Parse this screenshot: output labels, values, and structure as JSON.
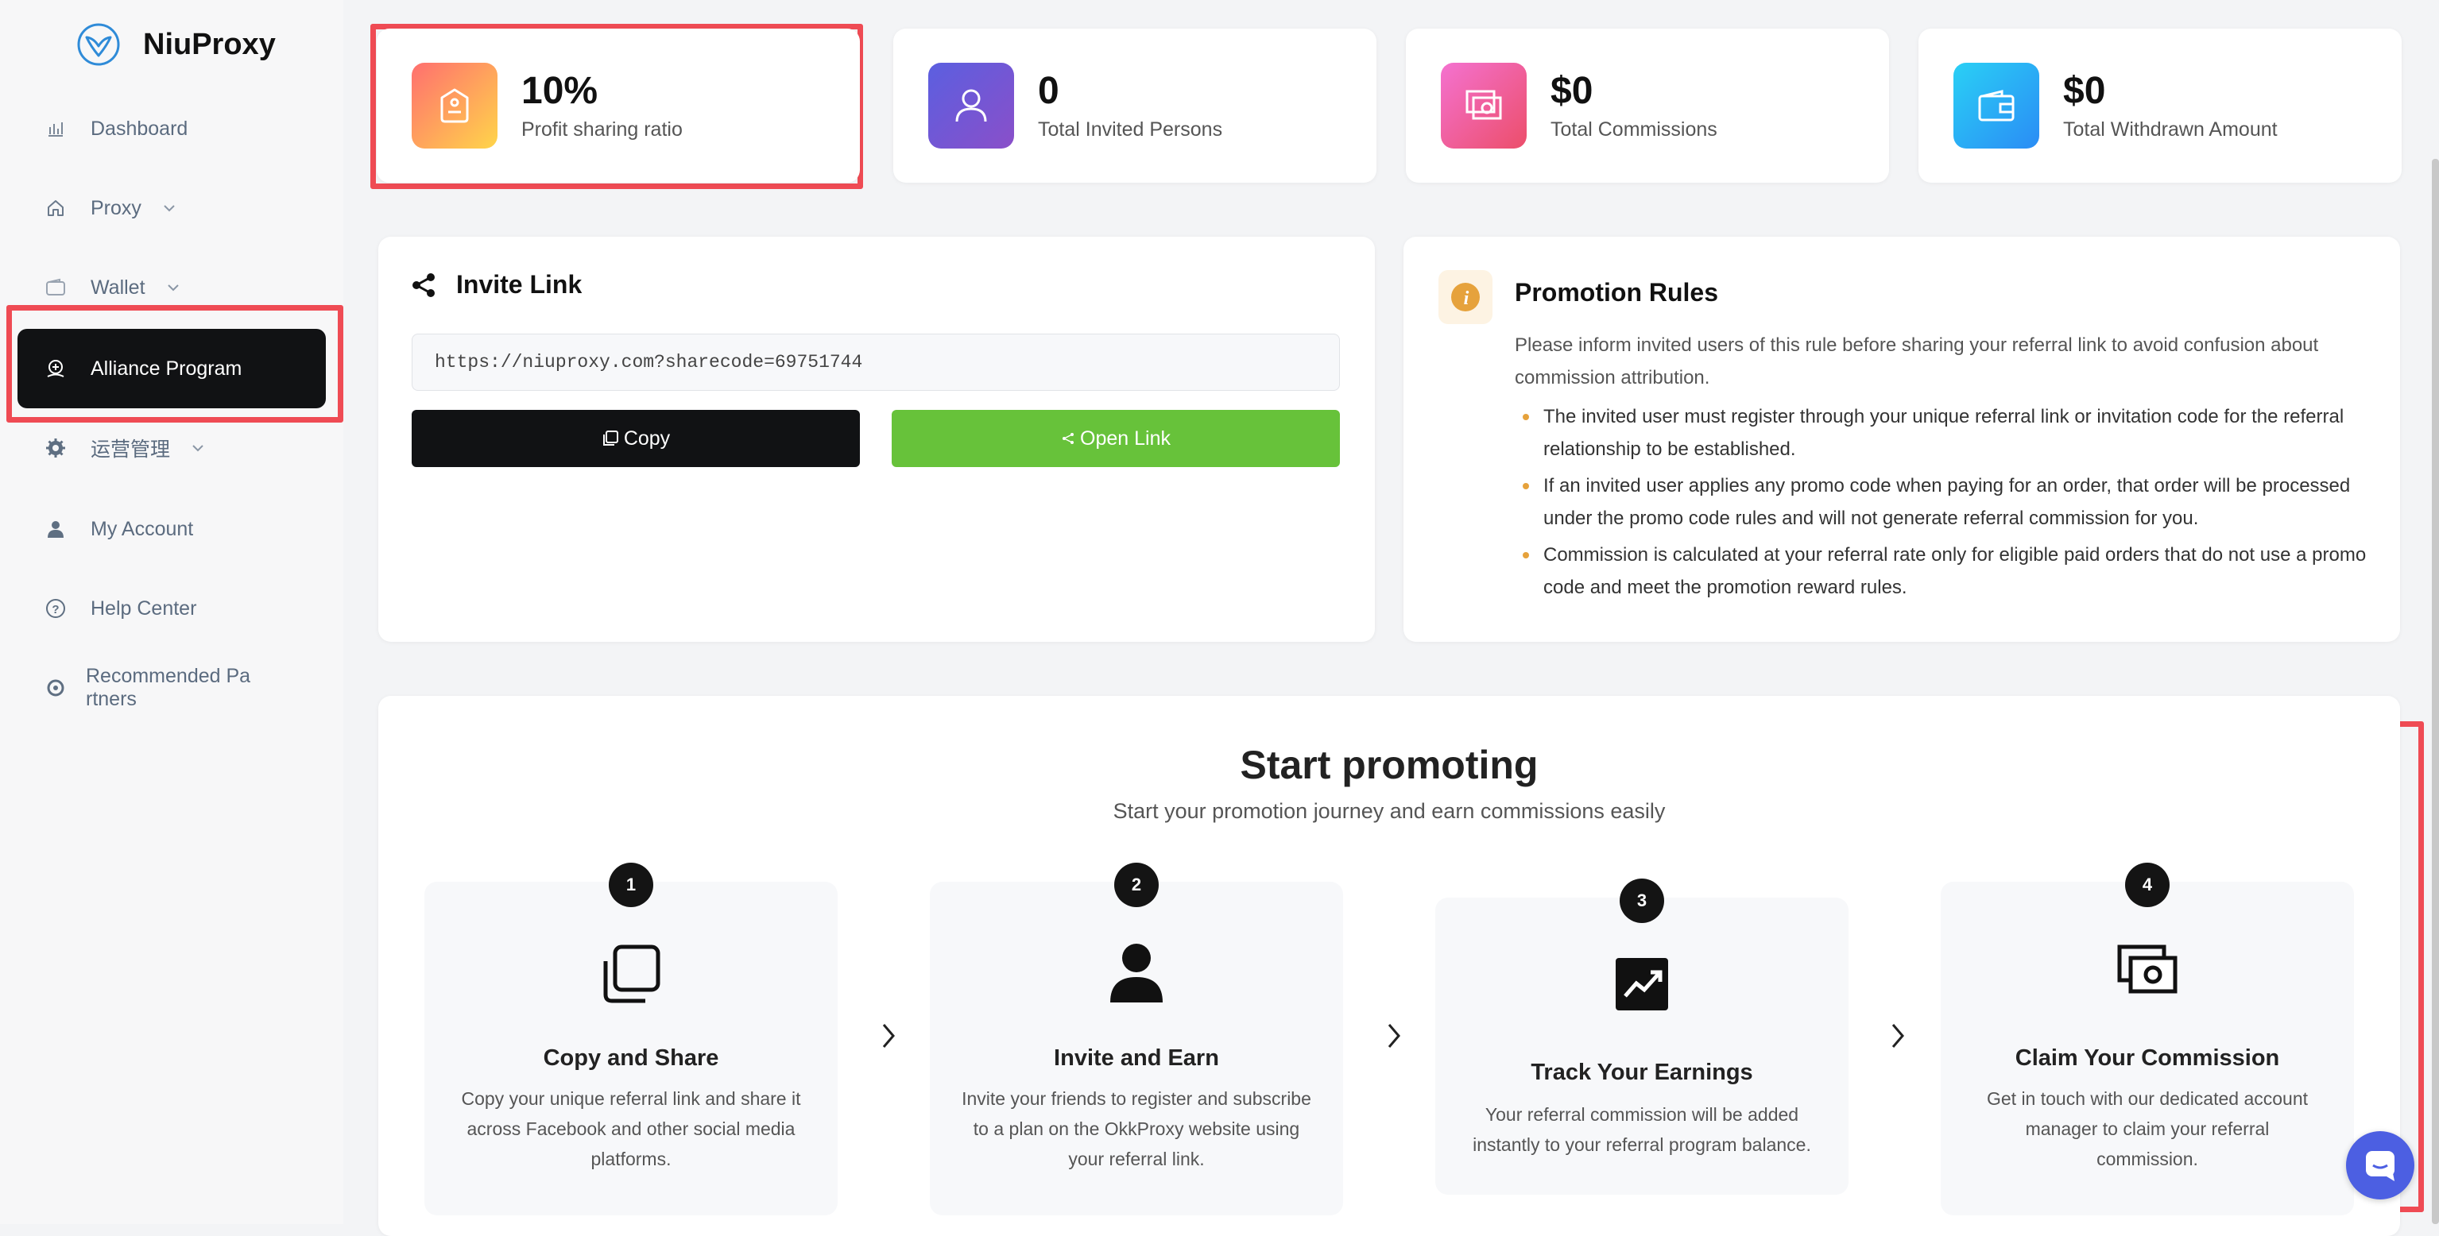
{
  "app": {
    "name": "NiuProxy",
    "logo_icon": "niuproxy-logo-icon"
  },
  "sidebar": {
    "items": [
      {
        "label": "Dashboard",
        "icon": "dashboard-icon",
        "active": false
      },
      {
        "label": "Proxy",
        "icon": "home-icon",
        "expandable": true
      },
      {
        "label": "Wallet",
        "icon": "wallet-icon",
        "expandable": true
      },
      {
        "label": "Alliance Program",
        "icon": "alliance-icon",
        "active": true
      },
      {
        "label": "运营管理",
        "icon": "gear-icon",
        "expandable": true
      },
      {
        "label": "My Account",
        "icon": "user-icon"
      },
      {
        "label": "Help Center",
        "icon": "help-icon"
      },
      {
        "label_line1": "Recommended Pa",
        "label_line2": "rtners",
        "icon": "partners-icon"
      }
    ]
  },
  "stats": [
    {
      "value": "10%",
      "label": "Profit sharing ratio",
      "icon": "tag-icon",
      "gradient": [
        "#ff6f6f",
        "#ffd54a"
      ]
    },
    {
      "value": "0",
      "label": "Total Invited Persons",
      "icon": "person-icon",
      "gradient": [
        "#5b5fe0",
        "#8a4fc9"
      ]
    },
    {
      "value": "$0",
      "label": "Total Commissions",
      "icon": "money-icon",
      "gradient": [
        "#f472d0",
        "#ec4e6a"
      ]
    },
    {
      "value": "$0",
      "label": "Total Withdrawn Amount",
      "icon": "wallet-icon",
      "gradient": [
        "#2ad0f5",
        "#2a8cf5"
      ]
    }
  ],
  "invite": {
    "title": "Invite Link",
    "link": "https://niuproxy.com?sharecode=69751744",
    "copy_label": "Copy",
    "open_label": "Open Link"
  },
  "rules": {
    "title": "Promotion Rules",
    "intro": "Please inform invited users of this rule before sharing your referral link to avoid confusion about commission attribution.",
    "items": [
      "The invited user must register through your unique referral link or invitation code for the referral relationship to be established.",
      "If an invited user applies any promo code when paying for an order, that order will be processed under the promo code rules and will not generate referral commission for you.",
      "Commission is calculated at your referral rate only for eligible paid orders that do not use a promo code and meet the promotion reward rules."
    ]
  },
  "promo": {
    "title": "Start promoting",
    "subtitle": "Start your promotion journey and earn commissions easily",
    "steps": [
      {
        "num": "1",
        "title": "Copy and Share",
        "icon": "copy-icon",
        "desc": "Copy your unique referral link and share it across Facebook and other social media platforms."
      },
      {
        "num": "2",
        "title": "Invite and Earn",
        "icon": "person-icon",
        "desc": "Invite your friends to register and subscribe to a plan on the OkkProxy website using your referral link."
      },
      {
        "num": "3",
        "title": "Track Your Earnings",
        "icon": "chart-icon",
        "desc": "Your referral commission will be added instantly to your referral program balance."
      },
      {
        "num": "4",
        "title": "Claim Your Commission",
        "icon": "money-icon",
        "desc": "Get in touch with our dedicated account manager to claim your referral commission."
      }
    ]
  },
  "colors": {
    "active_nav": "#111214",
    "copy_btn": "#111214",
    "open_btn": "#67c23a",
    "highlight": "#ef4b54",
    "chat": "#4c5fe2"
  }
}
